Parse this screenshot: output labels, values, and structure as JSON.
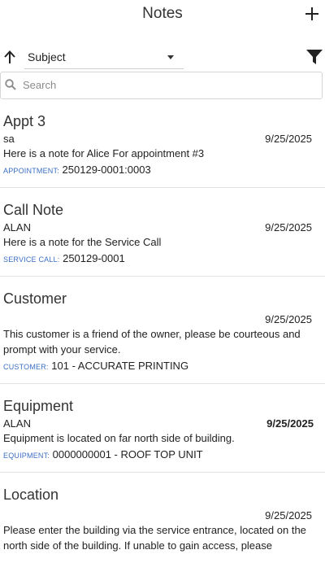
{
  "header": {
    "title": "Notes",
    "add_icon": "plus-icon"
  },
  "sort": {
    "direction_icon": "arrow-up-icon",
    "field": "Subject",
    "filter_icon": "filter-funnel-icon"
  },
  "search": {
    "placeholder": "Search",
    "value": "",
    "icon": "search-icon"
  },
  "notes": [
    {
      "title": "Appt 3",
      "author": "sa",
      "date": "9/25/2025",
      "body": "Here is a note for Alice For appointment #3",
      "ref_label": "APPOINTMENT:",
      "ref_value": "250129-0001:0003"
    },
    {
      "title": "Call Note",
      "author": "ALAN",
      "date": "9/25/2025",
      "body": "Here is a note for the Service Call",
      "ref_label": "SERVICE CALL:",
      "ref_value": "250129-0001"
    },
    {
      "title": "Customer",
      "author": "",
      "date": "9/25/2025",
      "body": "This customer is a friend of the owner, please be courteous and prompt with your service.",
      "ref_label": "CUSTOMER:",
      "ref_value": "101 - ACCURATE PRINTING"
    },
    {
      "title": "Equipment",
      "author": "ALAN",
      "date": "9/25/2025",
      "body": "Equipment is located on far north side of building.",
      "ref_label": "EQUIPMENT:",
      "ref_value": "0000000001 - ROOF TOP UNIT"
    },
    {
      "title": "Location",
      "author": "",
      "date": "9/25/2025",
      "body": "Please enter the building via the service entrance, located on the north side of the building. If unable to gain access, please"
    }
  ],
  "colors": {
    "ref_label": "#3b6fc4",
    "divider": "#e2e2e2",
    "text": "#222222"
  }
}
